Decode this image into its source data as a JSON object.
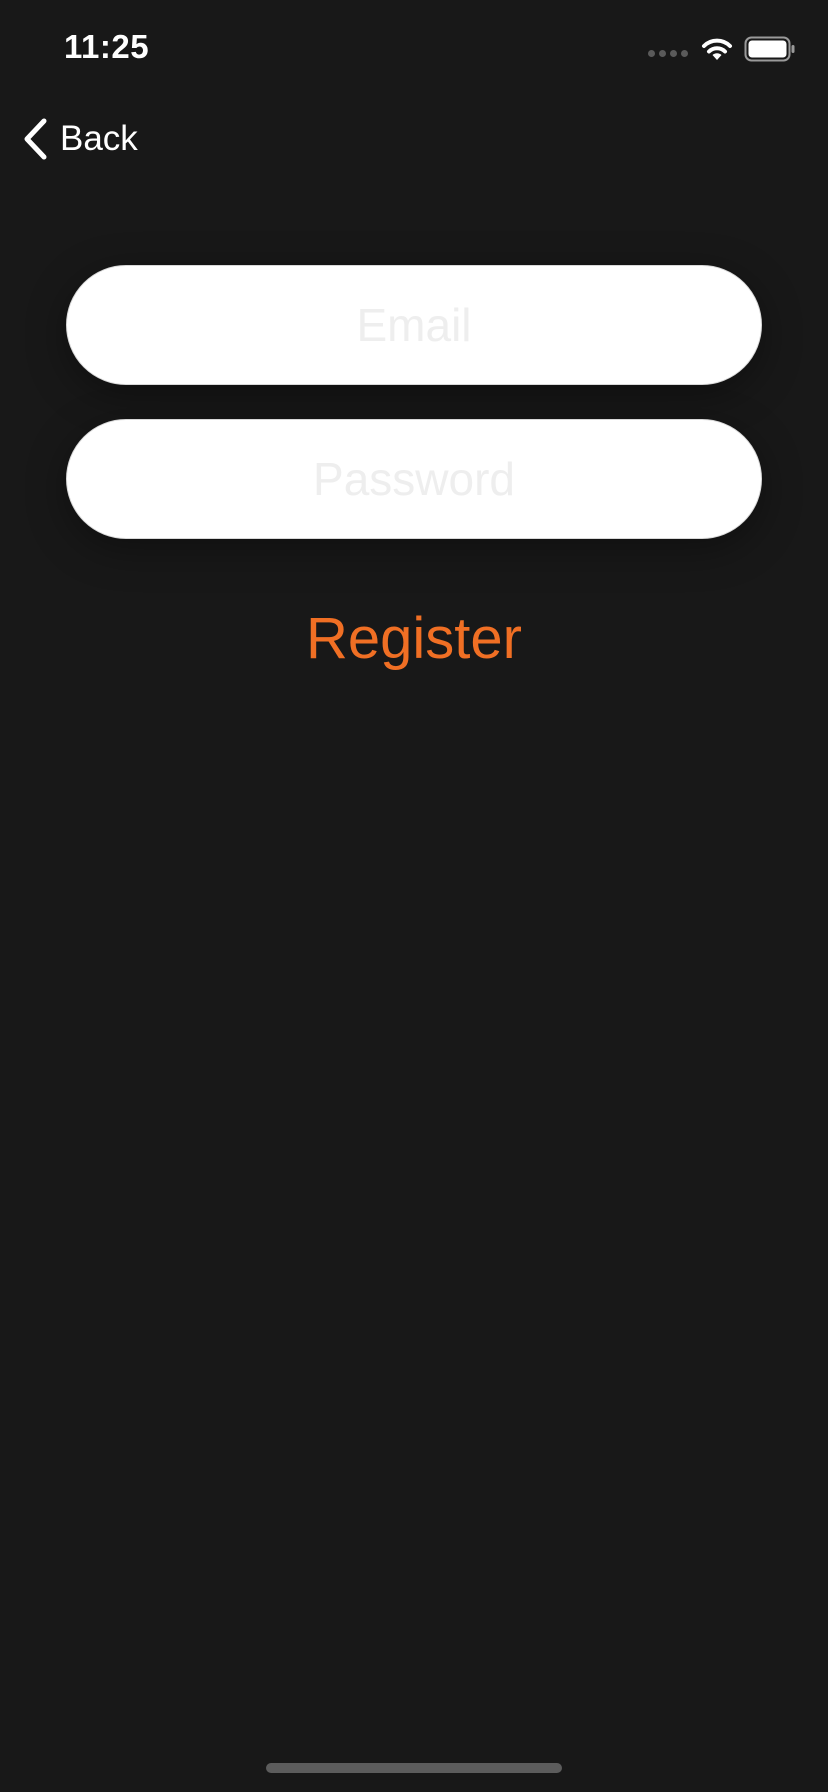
{
  "status_bar": {
    "time": "11:25",
    "icons": [
      "signal-dots-icon",
      "wifi-icon",
      "battery-icon"
    ]
  },
  "nav": {
    "back_label": "Back",
    "back_icon": "chevron-left-icon"
  },
  "form": {
    "email": {
      "value": "",
      "placeholder": "Email"
    },
    "password": {
      "value": "",
      "placeholder": "Password"
    },
    "register_label": "Register"
  },
  "colors": {
    "background": "#181818",
    "accent": "#f06f24",
    "field_background": "#ffffff"
  }
}
